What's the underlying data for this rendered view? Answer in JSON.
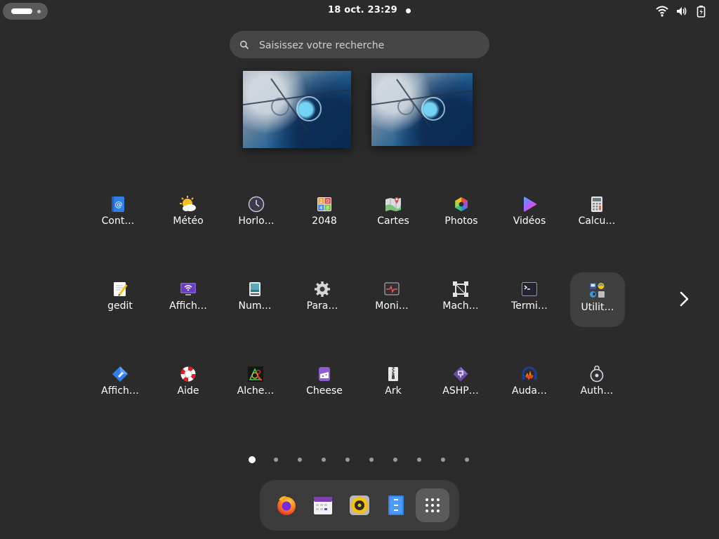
{
  "topbar": {
    "clock": "18 oct.  23:29",
    "tray_icons": [
      "wifi-icon",
      "volume-icon",
      "battery-icon"
    ]
  },
  "search": {
    "placeholder": "Saisissez votre recherche"
  },
  "workspaces": [
    "workspace-1",
    "workspace-2"
  ],
  "apps": [
    {
      "label": "Cont…",
      "icon": "contacts-icon"
    },
    {
      "label": "Météo",
      "icon": "weather-icon"
    },
    {
      "label": "Horlo…",
      "icon": "clock-icon"
    },
    {
      "label": "2048",
      "icon": "game-2048-icon"
    },
    {
      "label": "Cartes",
      "icon": "maps-icon"
    },
    {
      "label": "Photos",
      "icon": "photos-icon"
    },
    {
      "label": "Vidéos",
      "icon": "videos-icon"
    },
    {
      "label": "Calcu…",
      "icon": "calculator-icon"
    },
    {
      "label": "gedit",
      "icon": "text-editor-icon"
    },
    {
      "label": "Affich…",
      "icon": "remote-desktop-viewer-icon"
    },
    {
      "label": "Num…",
      "icon": "scanner-icon"
    },
    {
      "label": "Para…",
      "icon": "settings-icon"
    },
    {
      "label": "Moni…",
      "icon": "system-monitor-icon"
    },
    {
      "label": "Mach…",
      "icon": "virtual-machines-icon"
    },
    {
      "label": "Termi…",
      "icon": "terminal-icon"
    },
    {
      "label": "Utilit…",
      "icon": "utilities-folder-icon"
    },
    {
      "label": "Affich…",
      "icon": "document-viewer-icon"
    },
    {
      "label": "Aide",
      "icon": "help-icon"
    },
    {
      "label": "Alche…",
      "icon": "alchemy-icon"
    },
    {
      "label": "Cheese",
      "icon": "cheese-icon"
    },
    {
      "label": "Ark",
      "icon": "archive-icon"
    },
    {
      "label": "ASHP…",
      "icon": "ashpd-icon"
    },
    {
      "label": "Auda…",
      "icon": "audacity-icon"
    },
    {
      "label": "Auth…",
      "icon": "authenticator-icon"
    }
  ],
  "selected_app": "Utilit…",
  "pagination": {
    "pages": 10,
    "current": 1
  },
  "dash": [
    {
      "name": "firefox-icon"
    },
    {
      "name": "calendar-icon"
    },
    {
      "name": "rhythmbox-icon"
    },
    {
      "name": "files-icon"
    },
    {
      "name": "show-apps-icon"
    }
  ],
  "colors": {
    "background": "#2b2b2b",
    "panel": "#3b3b3b",
    "search_bg": "#464646",
    "selected_tile": "#3f3f3f"
  }
}
